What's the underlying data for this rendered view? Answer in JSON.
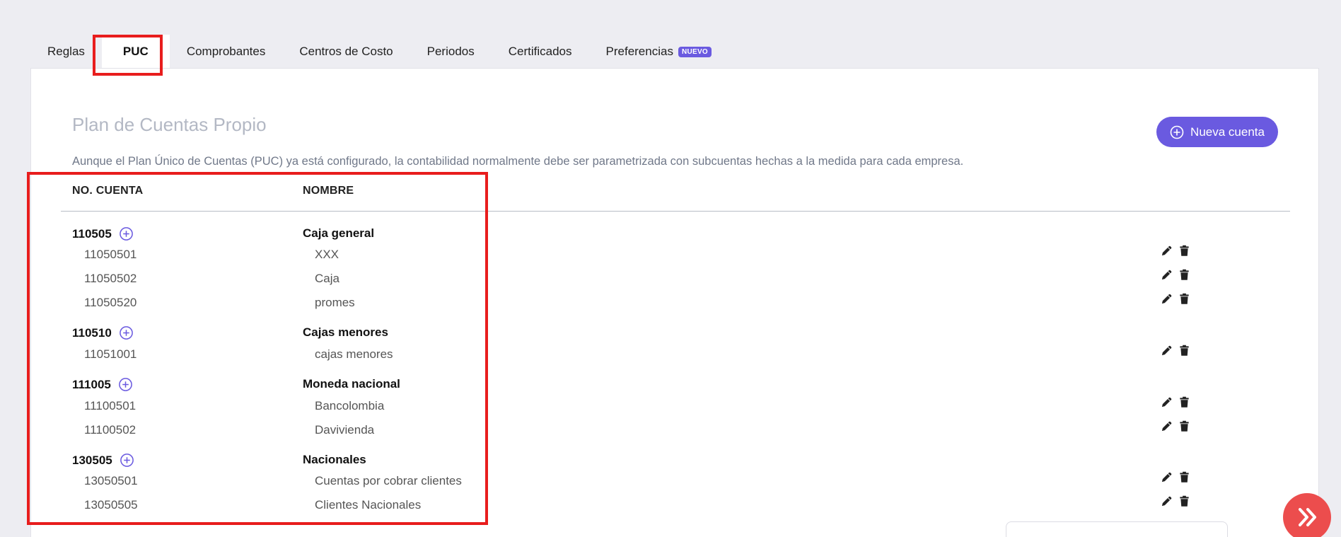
{
  "tabs": [
    {
      "label": "Reglas"
    },
    {
      "label": "PUC"
    },
    {
      "label": "Comprobantes"
    },
    {
      "label": "Centros de Costo"
    },
    {
      "label": "Periodos"
    },
    {
      "label": "Certificados"
    },
    {
      "label": "Preferencias",
      "badge": "NUEVO"
    }
  ],
  "page": {
    "title": "Plan de Cuentas Propio",
    "description": "Aunque el Plan Único de Cuentas (PUC) ya está configurado, la contabilidad normalmente debe ser parametrizada con subcuentas hechas a la medida para cada empresa.",
    "new_button": "Nueva cuenta"
  },
  "table": {
    "columns": {
      "code": "NO. CUENTA",
      "name": "NOMBRE"
    },
    "groups": [
      {
        "code": "110505",
        "name": "Caja general",
        "children": [
          {
            "code": "11050501",
            "name": "XXX"
          },
          {
            "code": "11050502",
            "name": "Caja"
          },
          {
            "code": "11050520",
            "name": "promes"
          }
        ]
      },
      {
        "code": "110510",
        "name": "Cajas menores",
        "children": [
          {
            "code": "11051001",
            "name": "cajas menores"
          }
        ]
      },
      {
        "code": "111005",
        "name": "Moneda nacional",
        "children": [
          {
            "code": "11100501",
            "name": "Bancolombia"
          },
          {
            "code": "11100502",
            "name": "Davivienda"
          }
        ]
      },
      {
        "code": "130505",
        "name": "Nacionales",
        "children": [
          {
            "code": "13050501",
            "name": "Cuentas por cobrar clientes"
          },
          {
            "code": "13050505",
            "name": "Clientes Nacionales"
          }
        ]
      }
    ]
  },
  "icons": {
    "add": "plus-circle-icon",
    "edit": "pencil-icon",
    "delete": "trash-icon",
    "fab": "double-chevron-right-icon"
  },
  "colors": {
    "accent": "#6a5ae0",
    "highlight": "#e81d1d",
    "fab": "#ec4d4d"
  }
}
